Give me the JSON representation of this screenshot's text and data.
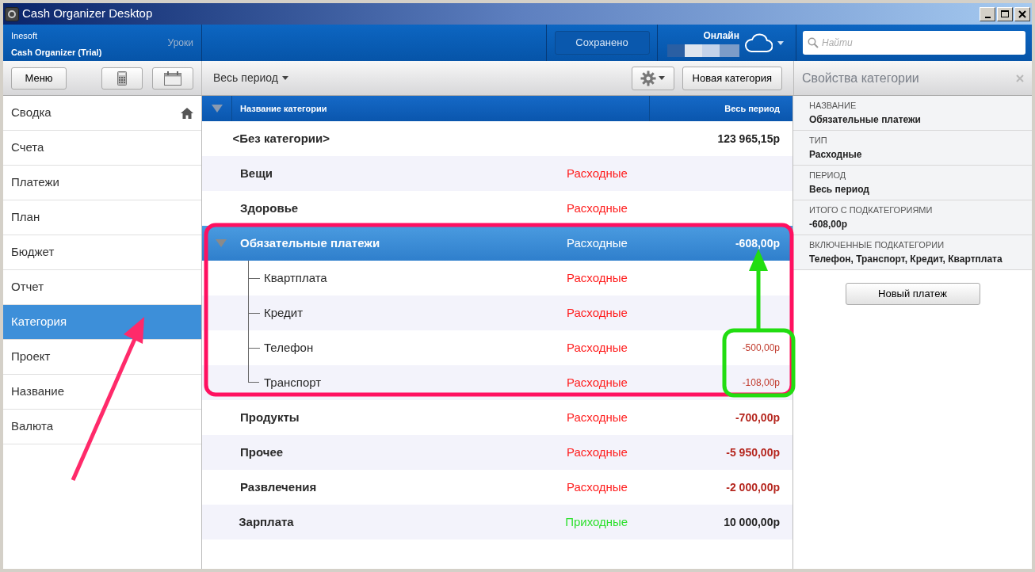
{
  "window": {
    "title": "Cash Organizer Desktop"
  },
  "header": {
    "company": "Inesoft",
    "product": "Cash Organizer (Trial)",
    "lessons_link": "Уроки",
    "save_status": "Сохранено",
    "sync_status": "Онлайн",
    "search": {
      "placeholder": "Найти"
    }
  },
  "toolbar": {
    "menu_button": "Меню",
    "period_dropdown": "Весь период",
    "new_category_button": "Новая категория"
  },
  "sidebar": {
    "items": [
      {
        "label": "Сводка",
        "selected": false,
        "home_icon": true
      },
      {
        "label": "Счета",
        "selected": false,
        "home_icon": false
      },
      {
        "label": "Платежи",
        "selected": false,
        "home_icon": false
      },
      {
        "label": "План",
        "selected": false,
        "home_icon": false
      },
      {
        "label": "Бюджет",
        "selected": false,
        "home_icon": false
      },
      {
        "label": "Отчет",
        "selected": false,
        "home_icon": false
      },
      {
        "label": "Категория",
        "selected": true,
        "home_icon": false
      },
      {
        "label": "Проект",
        "selected": false,
        "home_icon": false
      },
      {
        "label": "Название",
        "selected": false,
        "home_icon": false
      },
      {
        "label": "Валюта",
        "selected": false,
        "home_icon": false
      }
    ]
  },
  "table": {
    "columns": [
      "Название категории",
      "Весь период"
    ],
    "rows": [
      {
        "name": "<Без категории>",
        "amount": "123 965,15р",
        "negative": false,
        "selected": false
      },
      {
        "name": "Вещи",
        "type": "Расходные",
        "kind": "expense",
        "selected": false
      },
      {
        "name": "Здоровье",
        "type": "Расходные",
        "kind": "expense",
        "selected": false
      },
      {
        "name": "Обязательные платежи",
        "type": "Расходные",
        "kind": "expense",
        "amount": "-608,00р",
        "negative": true,
        "selected": true,
        "expanded": true,
        "children": [
          {
            "name": "Квартплата",
            "type": "Расходные",
            "kind": "expense",
            "selected": false
          },
          {
            "name": "Кредит",
            "type": "Расходные",
            "kind": "expense",
            "selected": false
          },
          {
            "name": "Телефон",
            "type": "Расходные",
            "kind": "expense",
            "amount": "-500,00р",
            "negative": true,
            "selected": false
          },
          {
            "name": "Транспорт",
            "type": "Расходные",
            "kind": "expense",
            "amount": "-108,00р",
            "negative": true,
            "selected": false
          }
        ]
      },
      {
        "name": "Продукты",
        "type": "Расходные",
        "kind": "expense",
        "amount": "-700,00р",
        "negative": true,
        "selected": false
      },
      {
        "name": "Прочее",
        "type": "Расходные",
        "kind": "expense",
        "amount": "-5 950,00р",
        "negative": true,
        "selected": false
      },
      {
        "name": "Развлечения",
        "type": "Расходные",
        "kind": "expense",
        "amount": "-2 000,00р",
        "negative": true,
        "selected": false
      },
      {
        "name": "Зарплата",
        "type": "Приходные",
        "kind": "income",
        "amount": "10 000,00р",
        "negative": false,
        "selected": false
      }
    ]
  },
  "properties_panel": {
    "title": "Свойства категории",
    "fields": [
      {
        "label": "НАЗВАНИЕ",
        "value": "Обязательные платежи"
      },
      {
        "label": "ТИП",
        "value": "Расходные"
      },
      {
        "label": "ПЕРИОД",
        "value": "Весь период"
      },
      {
        "label": "ИТОГО С ПОДКАТЕГОРИЯМИ",
        "value": "-608,00р"
      },
      {
        "label": "ВКЛЮЧЕННЫЕ ПОДКАТЕГОРИИ",
        "value": "Телефон, Транспорт, Кредит, Квартплата"
      }
    ],
    "new_payment_button": "Новый платеж"
  }
}
